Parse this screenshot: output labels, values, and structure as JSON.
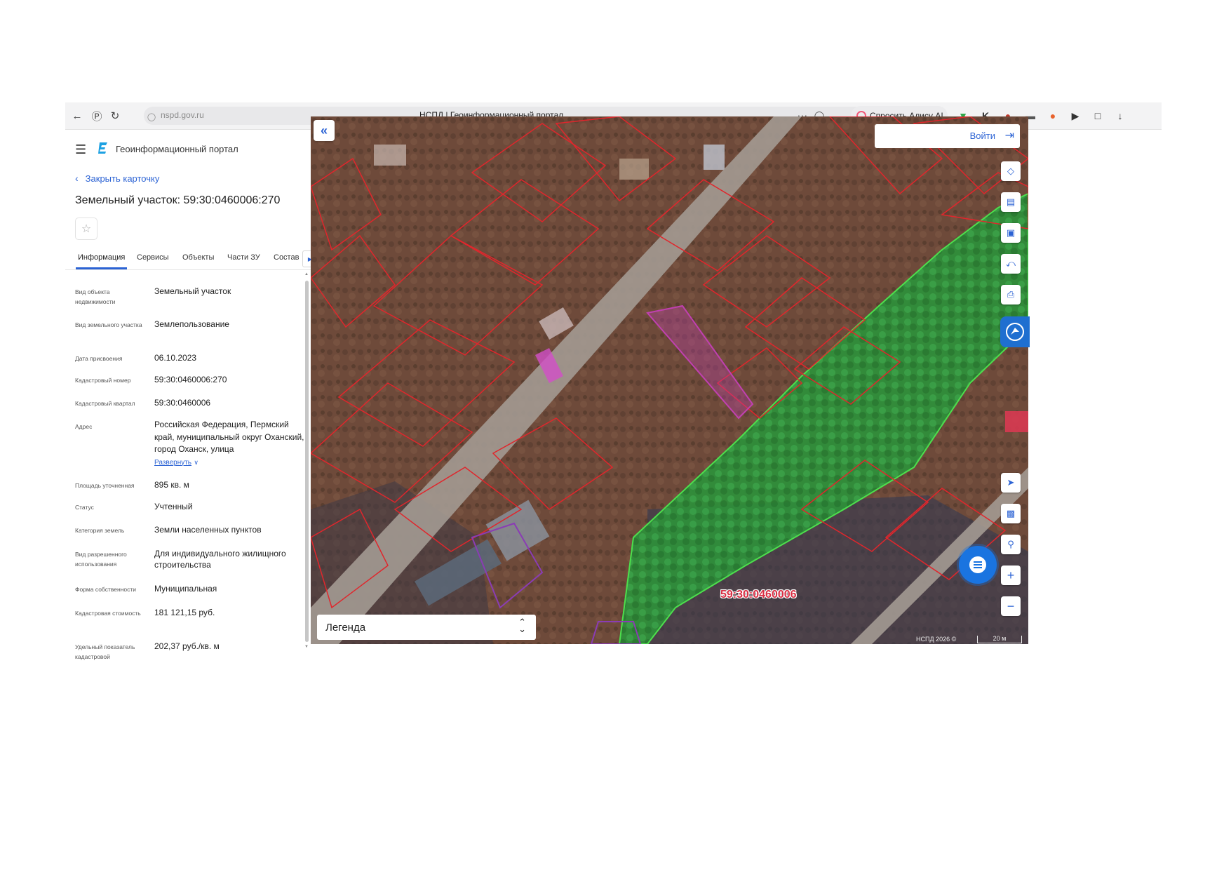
{
  "browser": {
    "url": "nspd.gov.ru",
    "title": "НСПД | Геоинформационный портал",
    "alice_button": "Спросить Алису AI"
  },
  "header": {
    "portal_name": "Геоинформационный портал"
  },
  "card": {
    "close_label": "Закрыть карточку",
    "title": "Земельный участок: 59:30:0460006:270"
  },
  "tabs": [
    {
      "label": "Информация"
    },
    {
      "label": "Сервисы"
    },
    {
      "label": "Объекты"
    },
    {
      "label": "Части ЗУ"
    },
    {
      "label": "Состав"
    }
  ],
  "info": [
    {
      "label": "Вид объекта недвижимости",
      "value": "Земельный участок"
    },
    {
      "label": "Вид земельного участка",
      "value": "Землепользование"
    },
    {
      "label": "Дата присвоения",
      "value": "06.10.2023"
    },
    {
      "label": "Кадастровый номер",
      "value": "59:30:0460006:270"
    },
    {
      "label": "Кадастровый квартал",
      "value": "59:30:0460006"
    },
    {
      "label": "Адрес",
      "value": "Российская Федерация, Пермский край, муниципальный округ Оханский, город Оханск, улица",
      "link": "Развернуть"
    },
    {
      "label": "Площадь уточненная",
      "value": "895 кв. м"
    },
    {
      "label": "Статус",
      "value": "Учтенный"
    },
    {
      "label": "Категория земель",
      "value": "Земли населенных пунктов"
    },
    {
      "label": "Вид разрешенного использования",
      "value": "Для индивидуального жилищного строительства"
    },
    {
      "label": "Форма собственности",
      "value": "Муниципальная"
    },
    {
      "label": "Кадастровая стоимость",
      "value": "181 121,15 руб."
    },
    {
      "label": "Удельный показатель кадастровой",
      "value": "202,37 руб./кв. м"
    }
  ],
  "map": {
    "login_label": "Войти",
    "legend_label": "Легенда",
    "quarter_label": "59:30:0460006",
    "copyright": "НСПД 2026 ©",
    "scale": "20 м"
  },
  "colors": {
    "accent": "#2c63d4",
    "parcel_outline": "#e0262c",
    "selected_parcel": "#c040b0",
    "forest_zone": "#2ecc40"
  }
}
